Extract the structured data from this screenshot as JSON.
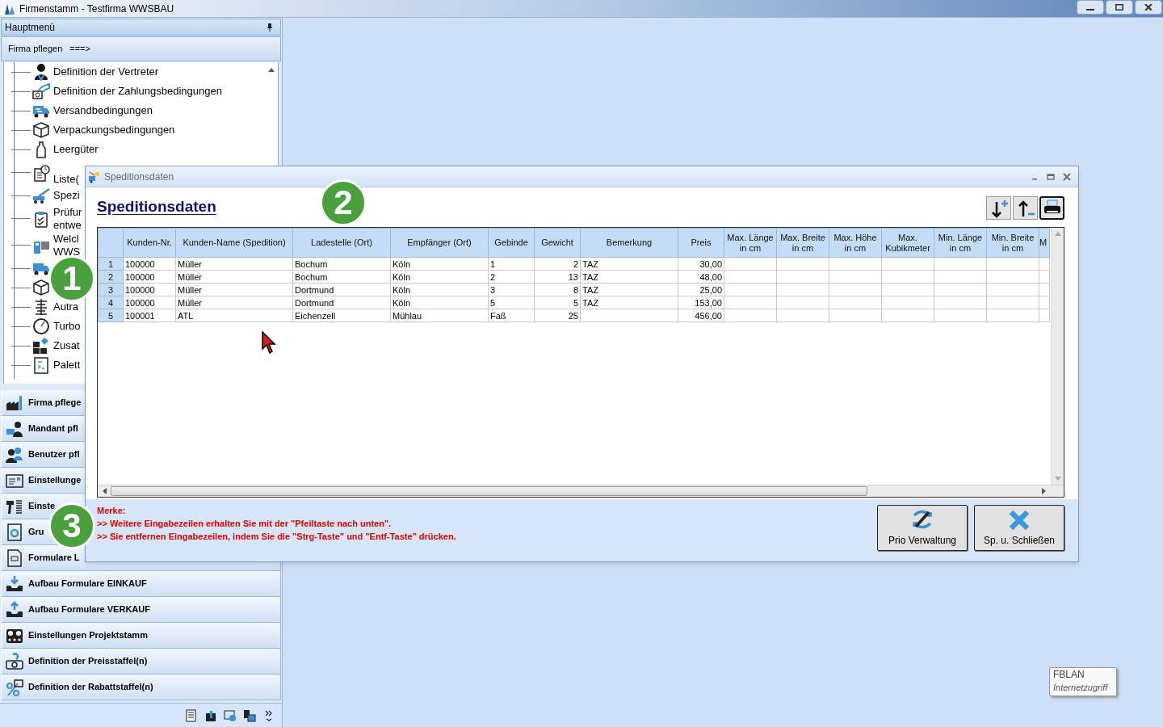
{
  "window": {
    "title": "Firmenstamm - Testfirma WWSBAU"
  },
  "main_menu": {
    "title": "Hauptmenü",
    "section": {
      "label": "Firma pflegen",
      "arrow": "===>"
    },
    "tree_items": [
      {
        "kind": "text",
        "lines": [
          "Definition der Vertreter"
        ]
      },
      {
        "kind": "text",
        "lines": [
          "Definition der Zahlungsbedingungen"
        ]
      },
      {
        "kind": "text",
        "lines": [
          "Versandbedingungen"
        ]
      },
      {
        "kind": "text",
        "lines": [
          "Verpackungsbedingungen"
        ]
      },
      {
        "kind": "text",
        "lines": [
          "Leergüter"
        ]
      },
      {
        "kind": "first_line_covered",
        "lines": [
          "Liste("
        ]
      },
      {
        "kind": "text",
        "lines": [
          "Spezi"
        ]
      },
      {
        "kind": "text",
        "lines": [
          "Prüfur",
          "entwe"
        ]
      },
      {
        "kind": "text",
        "lines": [
          "Welcl",
          "WWS"
        ]
      },
      {
        "kind": "icon_only"
      },
      {
        "kind": "icon_only"
      },
      {
        "kind": "text",
        "lines": [
          "Autra"
        ]
      },
      {
        "kind": "text",
        "lines": [
          "Turbo"
        ]
      },
      {
        "kind": "text",
        "lines": [
          "Zusat"
        ]
      },
      {
        "kind": "text",
        "lines": [
          "Palett"
        ]
      }
    ],
    "nav_buttons": [
      {
        "label": "Firma pflege"
      },
      {
        "label": "Mandant pfl"
      },
      {
        "label": "Benutzer pfl"
      },
      {
        "label": "Einstellunge"
      },
      {
        "label": "Einste"
      },
      {
        "label": "Gru"
      },
      {
        "label": "Formulare L"
      },
      {
        "label": "Aufbau Formulare EINKAUF"
      },
      {
        "label": "Aufbau Formulare VERKAUF"
      },
      {
        "label": "Einstellungen Projektstamm"
      },
      {
        "label": "Definition der Preisstaffel(n)"
      },
      {
        "label": "Definition der Rabattstaffel(n)"
      }
    ]
  },
  "dialog": {
    "title": "Speditionsdaten",
    "heading": "Speditionsdaten",
    "table": {
      "columns": [
        "Kunden-Nr.",
        "Kunden-Name (Spedition)",
        "Ladestelle (Ort)",
        "Empfänger (Ort)",
        "Gebinde",
        "Gewicht",
        "Bemerkung",
        "Preis",
        "Max. Länge in cm",
        "Max. Breite in cm",
        "Max. Höhe in cm",
        "Max. Kubikmeter",
        "Min. Länge in cm",
        "Min. Breite in cm",
        "M"
      ],
      "rows": [
        {
          "row_number": "1",
          "cells": [
            "100000",
            "Müller",
            "Bochum",
            "Köln",
            "1",
            "2",
            "TAZ",
            "30,00"
          ]
        },
        {
          "row_number": "2",
          "cells": [
            "100000",
            "Müller",
            "Bochum",
            "Köln",
            "2",
            "13",
            "TAZ",
            "48,00"
          ]
        },
        {
          "row_number": "3",
          "cells": [
            "100000",
            "Müller",
            "Dortmund",
            "Köln",
            "3",
            "8",
            "TAZ",
            "25,00"
          ]
        },
        {
          "row_number": "4",
          "cells": [
            "100000",
            "Müller",
            "Dortmund",
            "Köln",
            "5",
            "5",
            "TAZ",
            "153,00"
          ]
        },
        {
          "row_number": "5",
          "cells": [
            "100001",
            "ATL",
            "Eichenzell",
            "Mühlau",
            "Faß",
            "25",
            null,
            "456,00"
          ]
        }
      ]
    },
    "notes": {
      "title": "Merke:",
      "lines": [
        ">> Weitere Eingabezeilen erhalten Sie mit der \"Pfeiltaste nach unten\".",
        ">> Sie entfernen Eingabezeilen, indem Sie die \"Strg-Taste\" und \"Entf-Taste\" drücken."
      ]
    },
    "buttons": [
      {
        "label": "Prio Verwaltung"
      },
      {
        "label": "Sp. u. Schließen"
      }
    ]
  },
  "annotations": [
    {
      "label": "1"
    },
    {
      "label": "2"
    },
    {
      "label": "3"
    }
  ],
  "tooltip": {
    "title": "FBLAN",
    "subtitle": "Internetzugriff"
  }
}
